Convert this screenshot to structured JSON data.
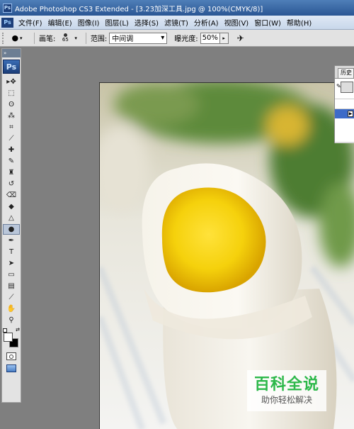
{
  "window": {
    "title": "Adobe Photoshop CS3 Extended - [3.23加深工具.jpg @ 100%(CMYK/8)]",
    "app_logo": "Ps"
  },
  "menubar": {
    "logo": "Ps",
    "items": [
      "文件(F)",
      "编辑(E)",
      "图像(I)",
      "图层(L)",
      "选择(S)",
      "滤镜(T)",
      "分析(A)",
      "视图(V)",
      "窗口(W)",
      "帮助(H)"
    ]
  },
  "options_bar": {
    "brush_label": "画笔:",
    "brush_size": "65",
    "range_label": "范围:",
    "range_value": "中间调",
    "exposure_label": "曝光度:",
    "exposure_value": "50%"
  },
  "toolbox": {
    "logo": "Ps",
    "tools": [
      {
        "name": "move-tool",
        "glyph": "▸✥"
      },
      {
        "name": "marquee-tool",
        "glyph": "⬚"
      },
      {
        "name": "lasso-tool",
        "glyph": "ʘ"
      },
      {
        "name": "magic-wand-tool",
        "glyph": "⁂"
      },
      {
        "name": "crop-tool",
        "glyph": "⌗"
      },
      {
        "name": "slice-tool",
        "glyph": "⟋"
      },
      {
        "name": "healing-brush-tool",
        "glyph": "✚"
      },
      {
        "name": "brush-tool",
        "glyph": "✎"
      },
      {
        "name": "clone-stamp-tool",
        "glyph": "♜"
      },
      {
        "name": "history-brush-tool",
        "glyph": "↺"
      },
      {
        "name": "eraser-tool",
        "glyph": "⌫"
      },
      {
        "name": "paint-bucket-tool",
        "glyph": "◆"
      },
      {
        "name": "blur-tool",
        "glyph": "△"
      },
      {
        "name": "dodge-burn-tool",
        "glyph": "●"
      },
      {
        "name": "pen-tool",
        "glyph": "✒"
      },
      {
        "name": "type-tool",
        "glyph": "T"
      },
      {
        "name": "path-selection-tool",
        "glyph": "➤"
      },
      {
        "name": "shape-tool",
        "glyph": "▭"
      },
      {
        "name": "notes-tool",
        "glyph": "▤"
      },
      {
        "name": "eyedropper-tool",
        "glyph": "⟋"
      },
      {
        "name": "hand-tool",
        "glyph": "✋"
      },
      {
        "name": "zoom-tool",
        "glyph": "⚲"
      }
    ],
    "active_tool": "dodge-burn-tool",
    "foreground_color": "#ffffff",
    "background_color": "#000000"
  },
  "history_panel": {
    "tab_label": "历史"
  },
  "watermark": {
    "title": "百科全说",
    "subtitle": "助你轻松解决"
  }
}
